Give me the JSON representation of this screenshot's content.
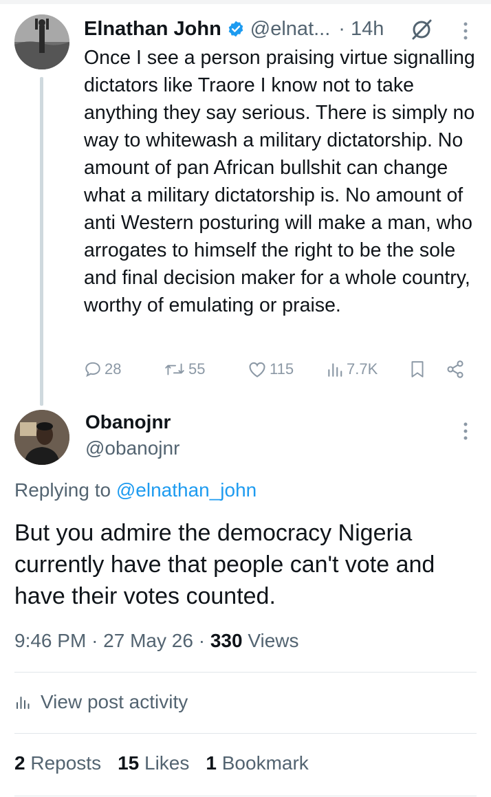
{
  "parent_tweet": {
    "author_name": "Elnathan John",
    "handle": "@elnat...",
    "time": "14h",
    "text": "Once I see a person praising virtue signalling dictators like Traore I know not to take anything they say serious. There is simply no way to whitewash a military dictatorship. No amount of pan African bullshit can change what a military dictatorship is. No amount of anti Western posturing will make a man, who arrogates to himself the right to be the sole and final decision maker for a whole country, worthy of emulating or praise.",
    "replies": "28",
    "reposts": "55",
    "likes": "115",
    "views": "7.7K"
  },
  "reply_tweet": {
    "author_name": "Obanojnr",
    "handle": "@obanojnr",
    "replying_prefix": "Replying to",
    "replying_mention": "@elnathan_john",
    "text": "But you admire the democracy Nigeria currently have that people can't vote and have their votes counted.",
    "time": "9:46 PM",
    "date": "27 May 26",
    "views_count": "330",
    "views_label": "Views"
  },
  "post_activity_label": "View post activity",
  "engagement": {
    "reposts_count": "2",
    "reposts_label": "Reposts",
    "likes_count": "15",
    "likes_label": "Likes",
    "bookmarks_count": "1",
    "bookmarks_label": "Bookmark"
  },
  "colors": {
    "accent": "#1d9bf0",
    "secondary_text": "#536471",
    "action_icons": "#8b98a5",
    "thread_line": "#cfd9de"
  },
  "icons": [
    "verified-badge-icon",
    "grok-icon",
    "more-vertical-icon",
    "reply-icon",
    "repost-icon",
    "like-icon",
    "views-icon",
    "bookmark-icon",
    "share-icon",
    "analytics-icon"
  ]
}
